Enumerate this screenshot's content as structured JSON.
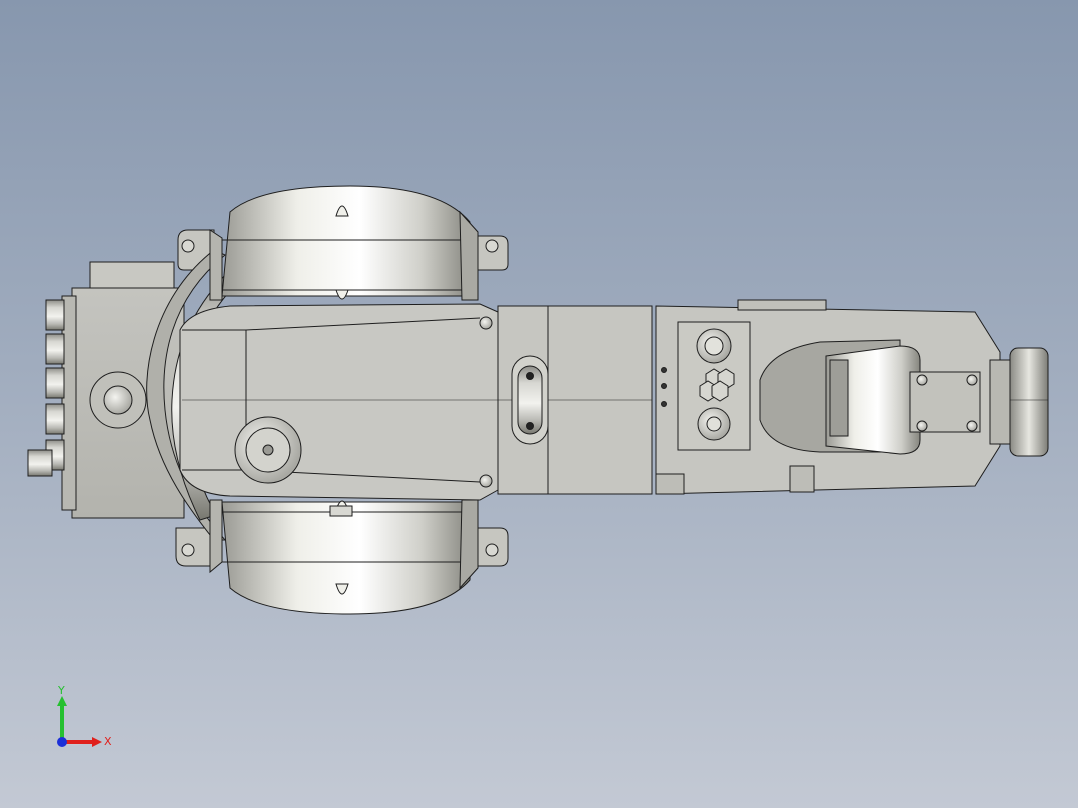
{
  "viewport": {
    "background_top": "#8797ae",
    "background_bottom": "#c3c9d4",
    "model_color": "#c9c9c4",
    "edge_color": "#1e1e1e"
  },
  "triad": {
    "x_label": "X",
    "y_label": "Y",
    "x_color": "#e0201c",
    "y_color": "#25c030",
    "z_color": "#1b2fd8"
  }
}
